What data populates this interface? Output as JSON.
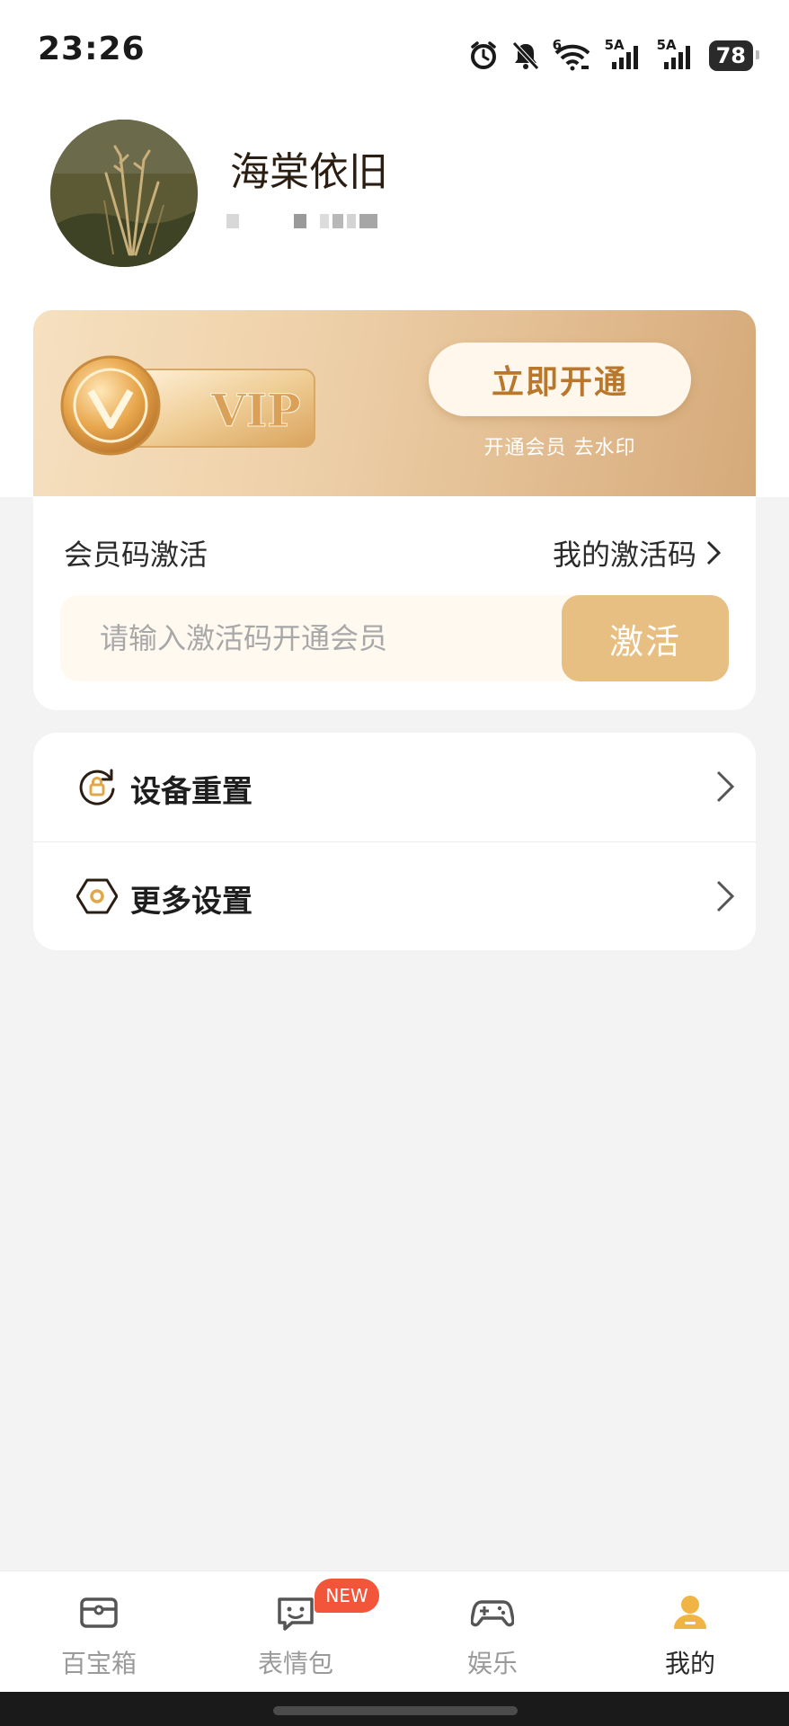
{
  "status_bar": {
    "time": "23:26",
    "signal1_label": "5A",
    "signal2_label": "5A",
    "wifi_label": "6",
    "battery": "78"
  },
  "profile": {
    "username": "海棠依旧"
  },
  "vip": {
    "badge_text": "VIP",
    "open_button": "立即开通",
    "subtitle": "开通会员 去水印"
  },
  "activation": {
    "title": "会员码激活",
    "my_codes_link": "我的激活码",
    "input_placeholder": "请输入激活码开通会员",
    "activate_button": "激活"
  },
  "menu": {
    "items": [
      {
        "label": "设备重置",
        "icon": "lock-refresh-icon"
      },
      {
        "label": "更多设置",
        "icon": "hexagon-settings-icon"
      }
    ]
  },
  "bottom_nav": {
    "items": [
      {
        "label": "百宝箱",
        "icon": "toolbox-icon"
      },
      {
        "label": "表情包",
        "icon": "chat-face-icon",
        "badge": "NEW"
      },
      {
        "label": "娱乐",
        "icon": "gamepad-icon"
      },
      {
        "label": "我的",
        "icon": "user-icon",
        "active": true
      }
    ]
  },
  "colors": {
    "accent_gold": "#e8bf82",
    "vip_text": "#b8772a",
    "badge_red": "#f2553a"
  }
}
